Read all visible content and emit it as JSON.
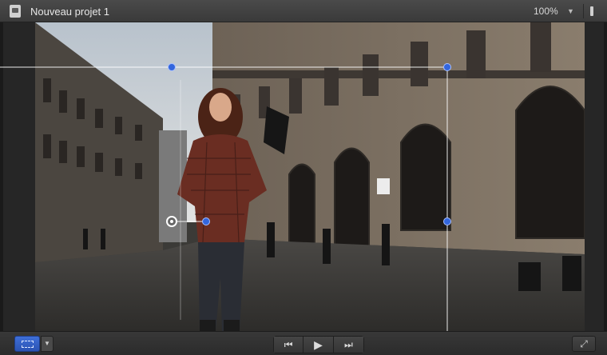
{
  "window": {
    "title": "Nouveau projet 1",
    "zoom_value": "100%",
    "zoom_caret_icon": "chevron-down-icon",
    "view_toggle_icon": "view-toggle-icon"
  },
  "toolbar": {
    "transform_icon": "transform-icon",
    "tool_menu_icon": "chevron-down-icon",
    "prev_icon": "go-to-start-icon",
    "play_icon": "play-icon",
    "next_icon": "go-to-end-icon",
    "fullscreen_icon": "fullscreen-icon",
    "prev_glyph": "⏮",
    "play_glyph": "▶",
    "next_glyph": "⏭",
    "fullscreen_glyph": "⤢",
    "caret_glyph": "▼"
  },
  "colors": {
    "handle": "#3366dd",
    "guide": "#ffffff",
    "toolbar_accent": "#2b53b3"
  }
}
